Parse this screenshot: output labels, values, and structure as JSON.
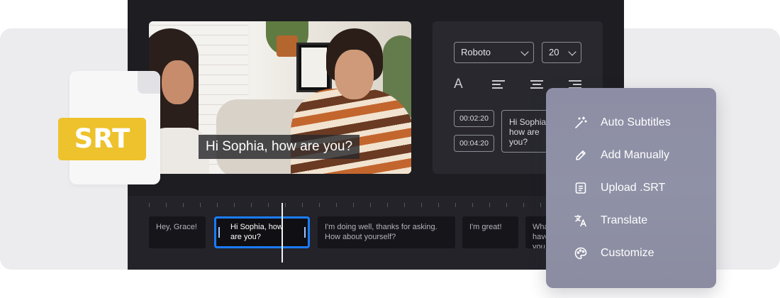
{
  "video": {
    "caption": "Hi Sophia, how are you?"
  },
  "settings": {
    "font": "Roboto",
    "size": "20",
    "text_icon": "A",
    "times": [
      "00:02:20",
      "00:04:20"
    ],
    "subtitle_text": "Hi Sophia, how are you?"
  },
  "timeline": {
    "clips": [
      "Hey, Grace!",
      "Hi Sophia, how are you?",
      "I'm doing well, thanks for asking. How about yourself?",
      "I'm great!",
      "What have you been up to lately for the"
    ]
  },
  "file": {
    "label": "SRT"
  },
  "menu": {
    "items": [
      {
        "label": "Auto Subtitles",
        "icon": "magic-wand-icon"
      },
      {
        "label": "Add Manually",
        "icon": "pencil-icon"
      },
      {
        "label": "Upload .SRT",
        "icon": "document-icon"
      },
      {
        "label": "Translate",
        "icon": "translate-icon"
      },
      {
        "label": "Customize",
        "icon": "palette-icon"
      }
    ]
  },
  "colors": {
    "accent": "#1b7cff",
    "srt_badge": "#eec22c",
    "editor_bg": "#1d1d22"
  }
}
